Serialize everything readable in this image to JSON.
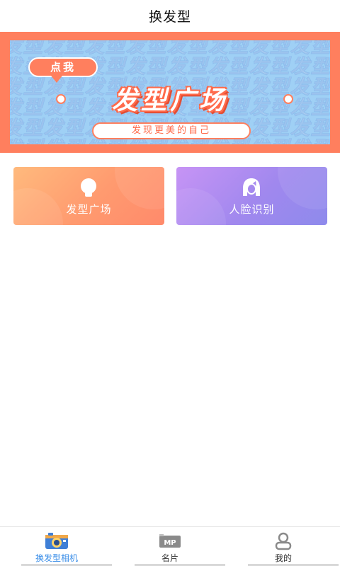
{
  "header": {
    "title": "换发型"
  },
  "banner": {
    "bubble_text": "点我",
    "title": "发型广场",
    "subtitle": "发现更美的自己",
    "pattern_text": "发型发型发型发型发型发型发型发型发型发型发型发型发型发型发型发型"
  },
  "cards": [
    {
      "label": "发型广场",
      "icon": "hair-head-icon",
      "colors": [
        "#ffba7d",
        "#ff8a6b"
      ]
    },
    {
      "label": "人脸识别",
      "icon": "face-female-icon",
      "colors": [
        "#c794f5",
        "#8e8aec"
      ]
    }
  ],
  "tabbar": {
    "items": [
      {
        "label": "换发型相机",
        "icon": "camera-icon",
        "active": true
      },
      {
        "label": "名片",
        "icon": "mp-card-icon",
        "active": false
      },
      {
        "label": "我的",
        "icon": "user-icon",
        "active": false
      }
    ],
    "active_color": "#3a8ee8"
  },
  "colors": {
    "banner_bg": "#ff7f5e",
    "banner_inner": "#9fd0f5"
  }
}
